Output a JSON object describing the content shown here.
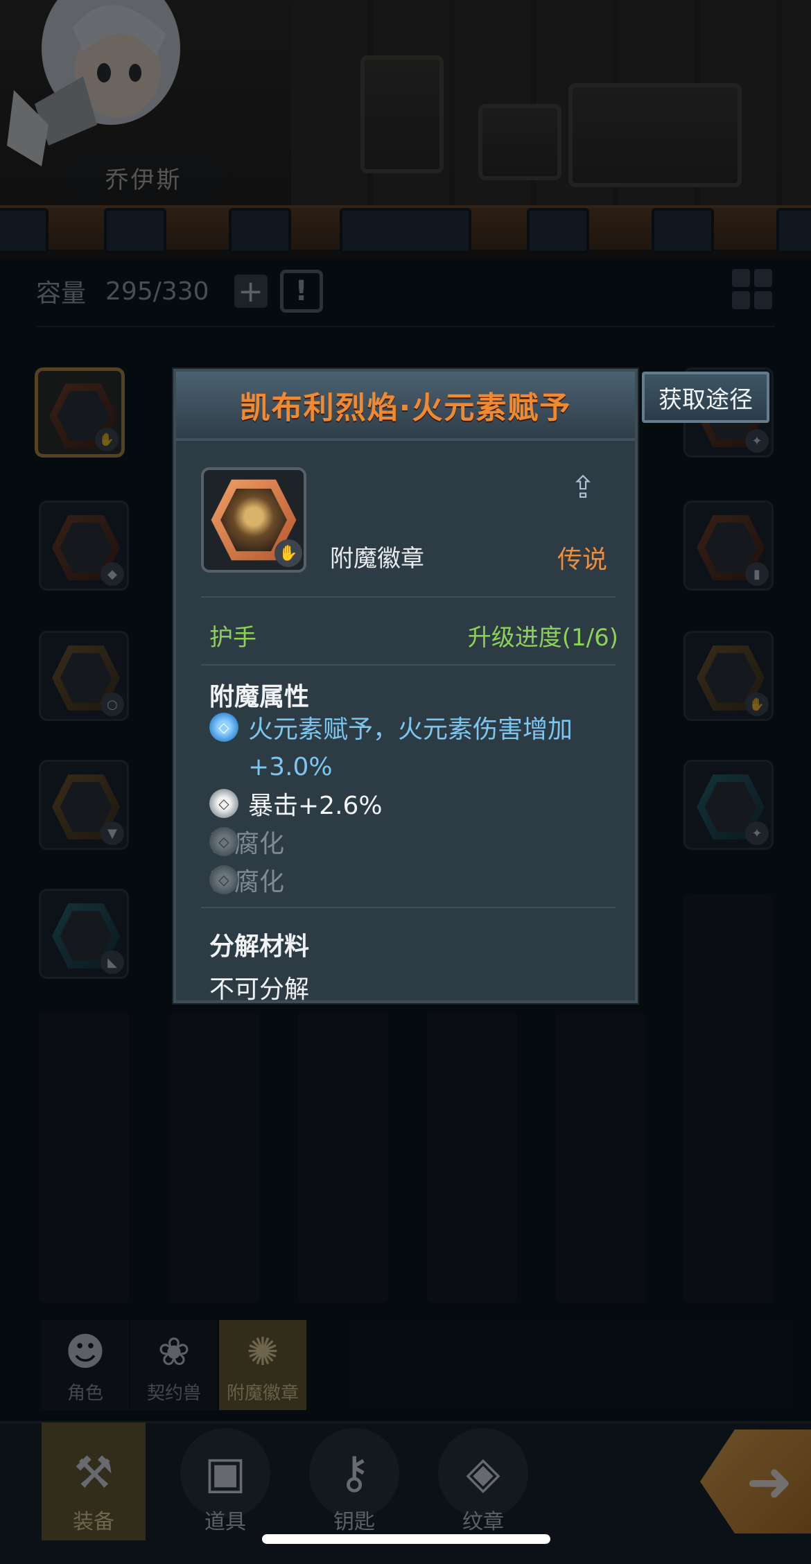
{
  "hero": {
    "name": "乔伊斯"
  },
  "inventory": {
    "capacity_label": "容量",
    "capacity_value": "295/330",
    "plus_icon": "+",
    "sort_icon": "!"
  },
  "popup": {
    "title": "凯布利烈焰·火元素赋予",
    "obtain_button": "获取途径",
    "item_type": "附魔徽章",
    "rarity": "传说",
    "slot": "护手",
    "upgrade_progress": "升级进度(1/6)",
    "enchant_title": "附魔属性",
    "attributes": [
      {
        "text": "火元素赋予，火元素伤害增加",
        "text2": "+3.0%",
        "style": "blue"
      },
      {
        "text": "暴击+2.6%",
        "style": "white"
      },
      {
        "text": "已腐化",
        "style": "dim"
      },
      {
        "text": "已腐化",
        "style": "dim"
      }
    ],
    "decompose_title": "分解材料",
    "decompose_value": "不可分解"
  },
  "subtabs": [
    {
      "label": "角色",
      "icon": "character-icon"
    },
    {
      "label": "契约兽",
      "icon": "paw-icon"
    },
    {
      "label": "附魔徽章",
      "icon": "badge-icon"
    }
  ],
  "bottom_nav": [
    {
      "label": "装备",
      "icon": "equipment-icon"
    },
    {
      "label": "道具",
      "icon": "chest-icon"
    },
    {
      "label": "钥匙",
      "icon": "key-icon"
    },
    {
      "label": "纹章",
      "icon": "crest-icon"
    }
  ],
  "colors": {
    "title_orange": "#f08a32",
    "rarity_orange": "#ee8d3a",
    "green": "#8dd05a",
    "attr_blue": "#7cc6ef",
    "popup_bg": "#2d3b45"
  }
}
